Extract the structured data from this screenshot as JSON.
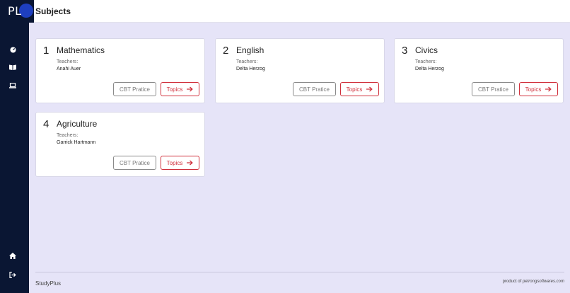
{
  "app": {
    "logo_text": "PL",
    "page_title": "Subjects"
  },
  "sidebar": {
    "items": [
      {
        "name": "dashboard",
        "icon": "gauge-icon"
      },
      {
        "name": "subjects",
        "icon": "book-open-icon"
      },
      {
        "name": "cbt",
        "icon": "laptop-icon"
      },
      {
        "name": "home",
        "icon": "home-icon"
      },
      {
        "name": "logout",
        "icon": "sign-out-icon"
      }
    ]
  },
  "subjects": [
    {
      "number": "1",
      "title": "Mathematics",
      "teachers_label": "Teachers:",
      "teacher": "Anahi Auer",
      "cbt_label": "CBT Pratice",
      "topics_label": "Topics"
    },
    {
      "number": "2",
      "title": "English",
      "teachers_label": "Teachers:",
      "teacher": "Delta Herzog",
      "cbt_label": "CBT Pratice",
      "topics_label": "Topics"
    },
    {
      "number": "3",
      "title": "Civics",
      "teachers_label": "Teachers:",
      "teacher": "Delta Herzog",
      "cbt_label": "CBT Pratice",
      "topics_label": "Topics"
    },
    {
      "number": "4",
      "title": "Agriculture",
      "teachers_label": "Teachers:",
      "teacher": "Garrick Hartmann",
      "cbt_label": "CBT Pratice",
      "topics_label": "Topics"
    }
  ],
  "footer": {
    "brand": "StudyPlus",
    "credit_prefix": "product of ",
    "credit_company": "petrongsoftwares.com"
  },
  "colors": {
    "sidebar": "#0a1633",
    "background": "#e6e4f8",
    "accent_red": "#d0303c",
    "logo_circle": "#1e3fbf"
  }
}
